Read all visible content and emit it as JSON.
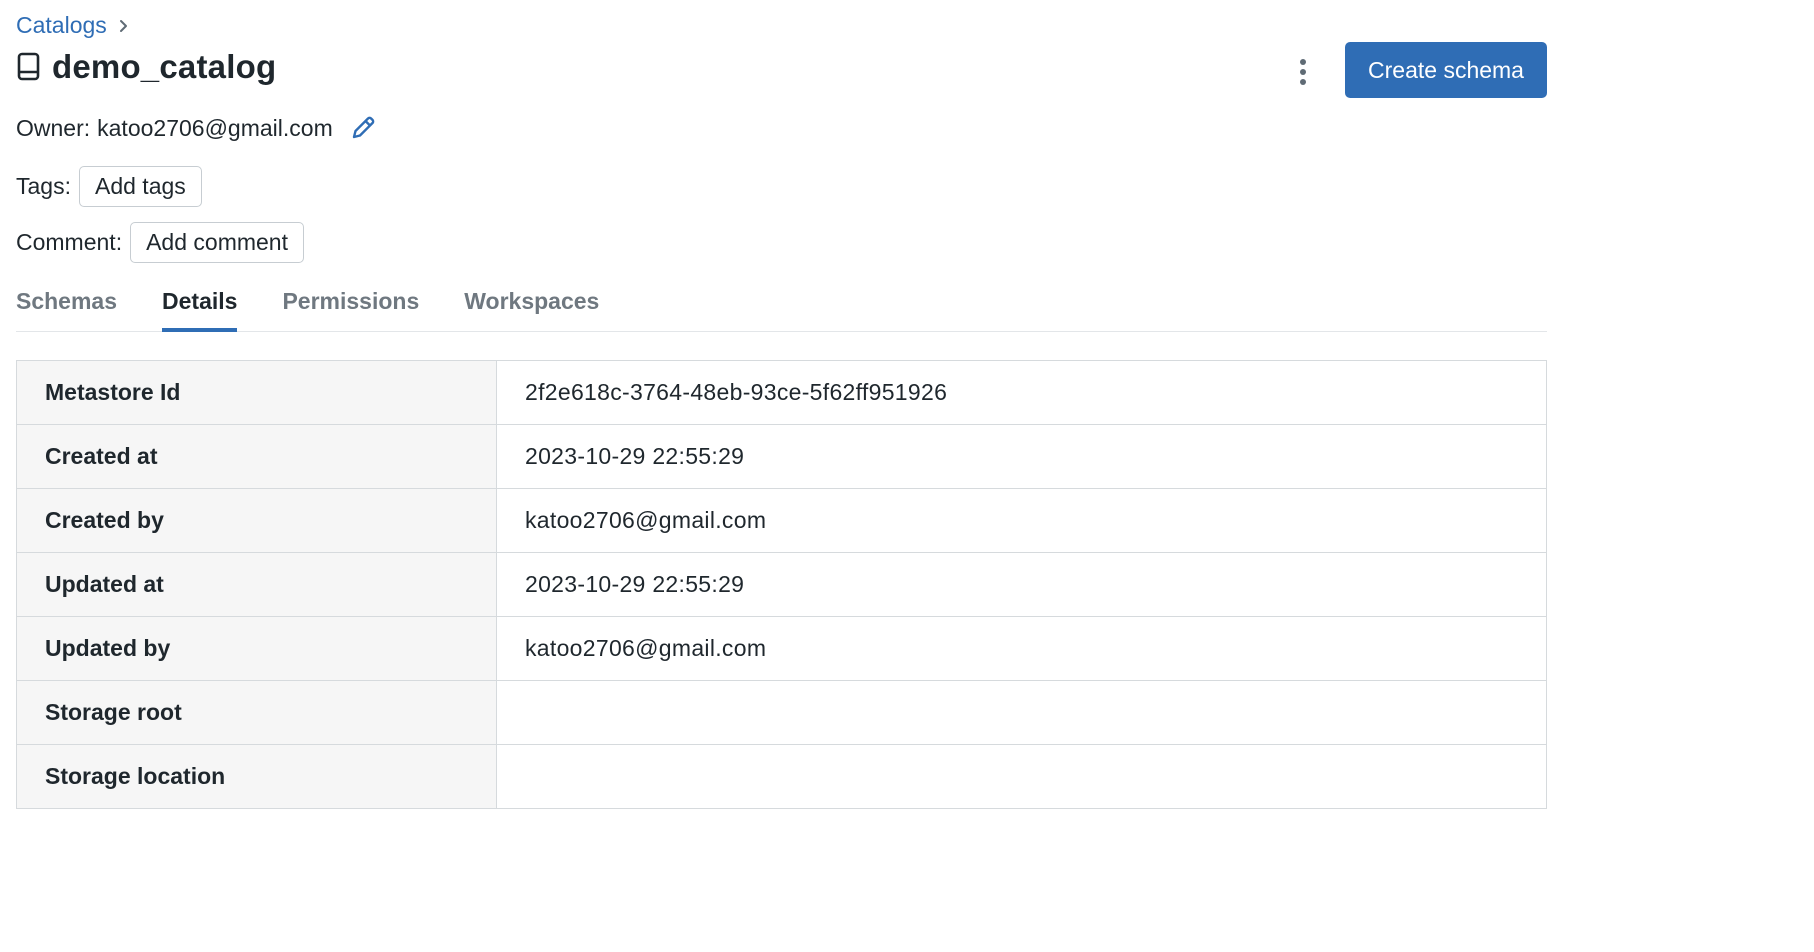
{
  "breadcrumb": {
    "catalogs_label": "Catalogs"
  },
  "header": {
    "title": "demo_catalog",
    "create_button_label": "Create schema"
  },
  "owner": {
    "label": "Owner:",
    "value": "katoo2706@gmail.com"
  },
  "tags": {
    "label": "Tags:",
    "button_label": "Add tags"
  },
  "comment": {
    "label": "Comment:",
    "button_label": "Add comment"
  },
  "tabs": [
    {
      "label": "Schemas",
      "active": false
    },
    {
      "label": "Details",
      "active": true
    },
    {
      "label": "Permissions",
      "active": false
    },
    {
      "label": "Workspaces",
      "active": false
    }
  ],
  "details": [
    {
      "key": "Metastore Id",
      "value": "2f2e618c-3764-48eb-93ce-5f62ff951926"
    },
    {
      "key": "Created at",
      "value": "2023-10-29 22:55:29"
    },
    {
      "key": "Created by",
      "value": "katoo2706@gmail.com"
    },
    {
      "key": "Updated at",
      "value": "2023-10-29 22:55:29"
    },
    {
      "key": "Updated by",
      "value": "katoo2706@gmail.com"
    },
    {
      "key": "Storage root",
      "value": ""
    },
    {
      "key": "Storage location",
      "value": ""
    }
  ],
  "colors": {
    "accent": "#2f6db5",
    "text": "#1f272d",
    "muted_text": "#6f7880",
    "key_cell_bg": "#f6f6f6",
    "border": "#d6dadd"
  },
  "icons": {
    "breadcrumb_separator": "chevron-right-icon",
    "title": "book-icon",
    "more_actions": "kebab-menu-icon",
    "edit_owner": "pencil-icon"
  }
}
